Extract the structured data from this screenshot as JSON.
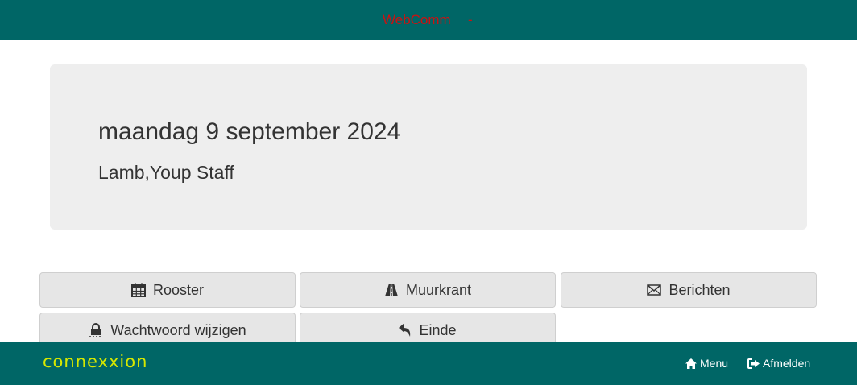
{
  "header": {
    "brand": "WebComm",
    "separator": "-"
  },
  "jumbotron": {
    "date": "maandag 9 september 2024",
    "user": "Lamb,Youp Staff"
  },
  "buttons": {
    "rooster": "Rooster",
    "muurkrant": "Muurkrant",
    "berichten": "Berichten",
    "wachtwoord": "Wachtwoord wijzigen",
    "einde": "Einde"
  },
  "footer": {
    "logo": "connexxion",
    "menu": "Menu",
    "afmelden": "Afmelden"
  },
  "colors": {
    "bar": "#006666",
    "brand": "#cc1111",
    "logo": "#d7e800"
  },
  "icons": {
    "rooster": "calendar-icon",
    "muurkrant": "road-icon",
    "berichten": "envelope-icon",
    "wachtwoord": "lock-icon",
    "einde": "reply-icon",
    "menu": "home-icon",
    "afmelden": "sign-out-icon"
  }
}
